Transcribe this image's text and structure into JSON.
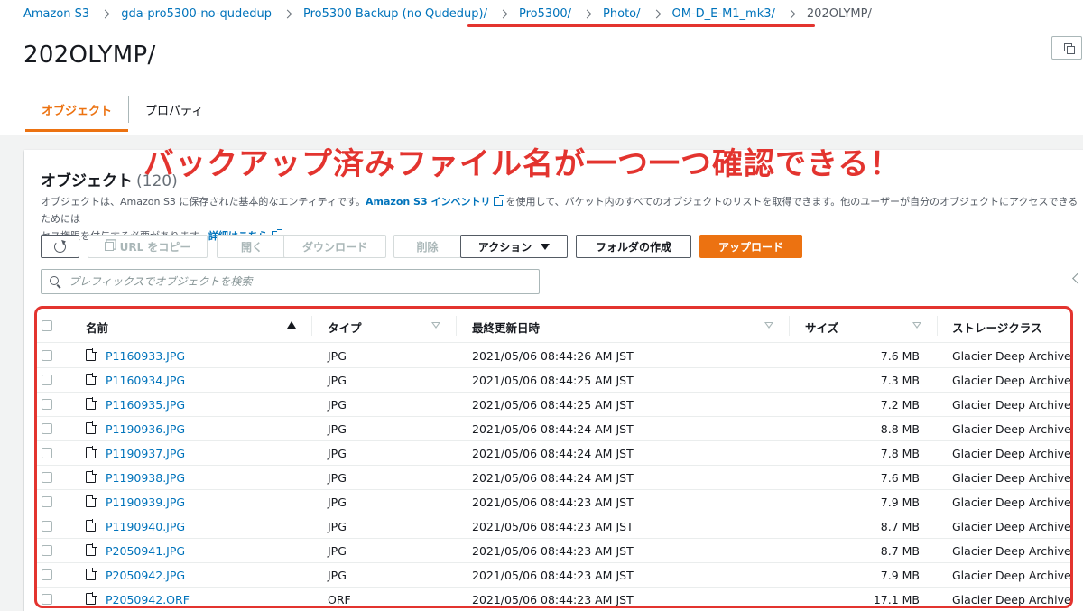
{
  "breadcrumb": [
    {
      "label": "Amazon S3",
      "current": false
    },
    {
      "label": "gda-pro5300-no-qudedup",
      "current": false
    },
    {
      "label": "Pro5300 Backup (no Qudedup)/",
      "current": false
    },
    {
      "label": "Pro5300/",
      "current": false
    },
    {
      "label": "Photo/",
      "current": false
    },
    {
      "label": "OM-D_E-M1_mk3/",
      "current": false
    },
    {
      "label": "202OLYMP/",
      "current": true
    }
  ],
  "page": {
    "title": "202OLYMP/"
  },
  "tabs": [
    {
      "label": "オブジェクト",
      "active": true
    },
    {
      "label": "プロパティ",
      "active": false
    }
  ],
  "objects": {
    "title": "オブジェクト",
    "count": "(120)",
    "description": {
      "part1": "オブジェクトは、Amazon S3 に保存された基本的なエンティティです。",
      "link1": "Amazon S3 インベントリ",
      "part2": "を使用して、バケット内のすべてのオブジェクトのリストを取得できます。他のユーザーが自分のオブジェクトにアクセスできるためには",
      "part3": "セス権限を付与する必要があります。",
      "link2": "詳細はこちら"
    }
  },
  "annotation": {
    "text": "バックアップ済みファイル名が一つ一つ確認できる！",
    "color": "#e3342f"
  },
  "toolbar": {
    "copy_url": "URL をコピー",
    "open": "開く",
    "download": "ダウンロード",
    "delete": "削除",
    "actions": "アクション",
    "create_folder": "フォルダの作成",
    "upload": "アップロード"
  },
  "search": {
    "placeholder": "プレフィックスでオブジェクトを検索",
    "value": ""
  },
  "table": {
    "columns": {
      "name": "名前",
      "type": "タイプ",
      "modified": "最終更新日時",
      "size": "サイズ",
      "storage": "ストレージクラス"
    },
    "rows": [
      {
        "name": "P1160933.JPG",
        "type": "JPG",
        "modified": "2021/05/06 08:44:26 AM JST",
        "size": "7.6 MB",
        "storage": "Glacier Deep Archive"
      },
      {
        "name": "P1160934.JPG",
        "type": "JPG",
        "modified": "2021/05/06 08:44:25 AM JST",
        "size": "7.3 MB",
        "storage": "Glacier Deep Archive"
      },
      {
        "name": "P1160935.JPG",
        "type": "JPG",
        "modified": "2021/05/06 08:44:25 AM JST",
        "size": "7.2 MB",
        "storage": "Glacier Deep Archive"
      },
      {
        "name": "P1190936.JPG",
        "type": "JPG",
        "modified": "2021/05/06 08:44:24 AM JST",
        "size": "8.8 MB",
        "storage": "Glacier Deep Archive"
      },
      {
        "name": "P1190937.JPG",
        "type": "JPG",
        "modified": "2021/05/06 08:44:24 AM JST",
        "size": "7.8 MB",
        "storage": "Glacier Deep Archive"
      },
      {
        "name": "P1190938.JPG",
        "type": "JPG",
        "modified": "2021/05/06 08:44:24 AM JST",
        "size": "7.6 MB",
        "storage": "Glacier Deep Archive"
      },
      {
        "name": "P1190939.JPG",
        "type": "JPG",
        "modified": "2021/05/06 08:44:23 AM JST",
        "size": "7.9 MB",
        "storage": "Glacier Deep Archive"
      },
      {
        "name": "P1190940.JPG",
        "type": "JPG",
        "modified": "2021/05/06 08:44:23 AM JST",
        "size": "8.7 MB",
        "storage": "Glacier Deep Archive"
      },
      {
        "name": "P2050941.JPG",
        "type": "JPG",
        "modified": "2021/05/06 08:44:23 AM JST",
        "size": "8.7 MB",
        "storage": "Glacier Deep Archive"
      },
      {
        "name": "P2050942.JPG",
        "type": "JPG",
        "modified": "2021/05/06 08:44:23 AM JST",
        "size": "7.9 MB",
        "storage": "Glacier Deep Archive"
      },
      {
        "name": "P2050942.ORF",
        "type": "ORF",
        "modified": "2021/05/06 08:44:23 AM JST",
        "size": "17.1 MB",
        "storage": "Glacier Deep Archive"
      }
    ]
  },
  "colors": {
    "link": "#0073bb",
    "primary": "#ec7211",
    "annotation": "#e3342f",
    "border": "#aab7b8"
  }
}
